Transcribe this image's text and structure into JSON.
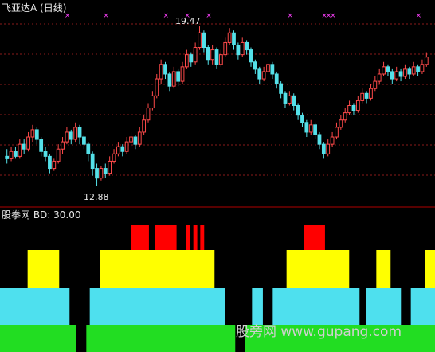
{
  "upper": {
    "title": "飞亚达A (日线)",
    "high_label": "19.47",
    "low_label": "12.88",
    "colors": {
      "up": "#ff4a4a",
      "down": "#54e0e8",
      "grid": "#8a1a1a",
      "marker": "#ff40ff",
      "border": "#b00000"
    },
    "candles": [
      [
        14.1,
        14.0,
        14.4,
        13.8
      ],
      [
        14.0,
        14.3,
        14.5,
        13.9
      ],
      [
        14.3,
        14.1,
        14.5,
        14.0
      ],
      [
        14.1,
        14.6,
        14.8,
        14.0
      ],
      [
        14.6,
        14.4,
        14.8,
        14.2
      ],
      [
        14.4,
        14.9,
        15.1,
        14.3
      ],
      [
        14.9,
        15.2,
        15.4,
        14.7
      ],
      [
        15.2,
        14.8,
        15.3,
        14.6
      ],
      [
        14.8,
        14.3,
        14.9,
        14.1
      ],
      [
        14.3,
        14.1,
        14.5,
        13.9
      ],
      [
        14.1,
        13.6,
        14.2,
        13.4
      ],
      [
        13.6,
        13.9,
        14.0,
        13.5
      ],
      [
        13.9,
        14.4,
        14.6,
        13.8
      ],
      [
        14.4,
        14.7,
        14.9,
        14.2
      ],
      [
        14.7,
        15.1,
        15.3,
        14.6
      ],
      [
        15.1,
        14.8,
        15.2,
        14.6
      ],
      [
        14.8,
        15.3,
        15.5,
        14.7
      ],
      [
        15.3,
        14.9,
        15.4,
        14.6
      ],
      [
        14.9,
        14.6,
        15.0,
        14.4
      ],
      [
        14.6,
        14.2,
        14.7,
        13.9
      ],
      [
        14.2,
        13.6,
        14.3,
        13.3
      ],
      [
        13.6,
        13.2,
        13.8,
        12.88
      ],
      [
        13.2,
        13.6,
        13.7,
        13.1
      ],
      [
        13.6,
        13.4,
        13.8,
        13.2
      ],
      [
        13.4,
        13.9,
        14.1,
        13.3
      ],
      [
        13.9,
        14.2,
        14.4,
        13.8
      ],
      [
        14.2,
        14.5,
        14.7,
        14.1
      ],
      [
        14.5,
        14.3,
        14.6,
        14.1
      ],
      [
        14.3,
        14.7,
        14.9,
        14.2
      ],
      [
        14.7,
        14.9,
        15.1,
        14.5
      ],
      [
        14.9,
        14.6,
        15.0,
        14.4
      ],
      [
        14.6,
        15.1,
        15.3,
        14.5
      ],
      [
        15.1,
        15.6,
        15.8,
        15.0
      ],
      [
        15.6,
        16.1,
        16.3,
        15.5
      ],
      [
        16.1,
        16.6,
        16.8,
        16.0
      ],
      [
        16.6,
        17.3,
        17.5,
        16.5
      ],
      [
        17.3,
        17.9,
        18.1,
        17.1
      ],
      [
        17.9,
        17.5,
        18.0,
        17.3
      ],
      [
        17.5,
        17.0,
        17.6,
        16.8
      ],
      [
        17.0,
        17.6,
        17.8,
        16.9
      ],
      [
        17.6,
        17.2,
        17.7,
        17.0
      ],
      [
        17.2,
        17.8,
        18.0,
        17.1
      ],
      [
        17.8,
        18.3,
        18.5,
        17.7
      ],
      [
        18.3,
        18.0,
        18.4,
        17.8
      ],
      [
        18.0,
        18.6,
        18.8,
        17.9
      ],
      [
        18.6,
        19.2,
        19.47,
        18.5
      ],
      [
        19.2,
        18.6,
        19.3,
        18.4
      ],
      [
        18.6,
        18.1,
        18.7,
        17.9
      ],
      [
        18.1,
        18.5,
        18.7,
        17.9
      ],
      [
        18.5,
        17.9,
        18.6,
        17.7
      ],
      [
        17.9,
        18.3,
        18.5,
        17.8
      ],
      [
        18.3,
        18.8,
        19.0,
        18.2
      ],
      [
        18.8,
        19.2,
        19.4,
        18.7
      ],
      [
        19.2,
        18.7,
        19.3,
        18.5
      ],
      [
        18.7,
        18.3,
        18.8,
        18.1
      ],
      [
        18.3,
        18.8,
        19.0,
        18.2
      ],
      [
        18.8,
        18.5,
        18.9,
        18.3
      ],
      [
        18.5,
        18.0,
        18.6,
        17.8
      ],
      [
        18.0,
        17.7,
        18.1,
        17.5
      ],
      [
        17.7,
        17.3,
        17.8,
        17.1
      ],
      [
        17.3,
        17.6,
        17.8,
        17.2
      ],
      [
        17.6,
        17.9,
        18.1,
        17.5
      ],
      [
        17.9,
        17.5,
        18.0,
        17.3
      ],
      [
        17.5,
        17.1,
        17.6,
        16.9
      ],
      [
        17.1,
        16.7,
        17.2,
        16.5
      ],
      [
        16.7,
        16.3,
        16.8,
        16.1
      ],
      [
        16.3,
        16.6,
        16.8,
        16.2
      ],
      [
        16.6,
        16.2,
        16.7,
        16.0
      ],
      [
        16.2,
        15.8,
        16.3,
        15.6
      ],
      [
        15.8,
        15.5,
        15.9,
        15.3
      ],
      [
        15.5,
        15.1,
        15.6,
        14.9
      ],
      [
        15.1,
        15.4,
        15.6,
        15.0
      ],
      [
        15.4,
        15.0,
        15.5,
        14.8
      ],
      [
        15.0,
        14.6,
        15.1,
        14.4
      ],
      [
        14.6,
        14.2,
        14.7,
        14.0
      ],
      [
        14.2,
        14.6,
        14.8,
        14.1
      ],
      [
        14.6,
        14.9,
        15.1,
        14.5
      ],
      [
        14.9,
        15.3,
        15.5,
        14.8
      ],
      [
        15.3,
        15.6,
        15.8,
        15.2
      ],
      [
        15.6,
        15.9,
        16.1,
        15.5
      ],
      [
        15.9,
        16.2,
        16.4,
        15.8
      ],
      [
        16.2,
        16.0,
        16.3,
        15.8
      ],
      [
        16.0,
        16.4,
        16.6,
        15.9
      ],
      [
        16.4,
        16.7,
        16.9,
        16.3
      ],
      [
        16.7,
        16.5,
        16.8,
        16.3
      ],
      [
        16.5,
        16.9,
        17.1,
        16.4
      ],
      [
        16.9,
        17.2,
        17.4,
        16.8
      ],
      [
        17.2,
        17.5,
        17.7,
        17.1
      ],
      [
        17.5,
        17.8,
        18.0,
        17.4
      ],
      [
        17.8,
        17.6,
        17.9,
        17.4
      ],
      [
        17.6,
        17.3,
        17.7,
        17.1
      ],
      [
        17.3,
        17.6,
        17.8,
        17.2
      ],
      [
        17.6,
        17.4,
        17.7,
        17.2
      ],
      [
        17.4,
        17.7,
        17.9,
        17.3
      ],
      [
        17.7,
        17.5,
        17.8,
        17.3
      ],
      [
        17.5,
        17.8,
        18.0,
        17.4
      ],
      [
        17.8,
        17.6,
        17.9,
        17.4
      ],
      [
        17.6,
        17.9,
        18.1,
        17.5
      ],
      [
        17.9,
        18.2,
        18.4,
        17.8
      ]
    ],
    "marker_days": [
      14,
      23,
      37,
      42,
      47,
      66,
      74,
      75,
      76,
      96,
      108,
      113,
      114,
      115,
      117,
      123
    ]
  },
  "lower": {
    "title": "股拳网 BD: 30.00",
    "colors": {
      "red": "#ff0000",
      "yellow": "#ffff00",
      "cyan": "#4ee0ee",
      "green": "#22dd22"
    },
    "levels": [
      2,
      2,
      2,
      2,
      2,
      2,
      2,
      2,
      3,
      3,
      3,
      3,
      3,
      3,
      3,
      3,
      3,
      2,
      2,
      2,
      1,
      1,
      0,
      0,
      0,
      1,
      2,
      2,
      2,
      3,
      3,
      3,
      3,
      3,
      3,
      3,
      3,
      3,
      4,
      4,
      4,
      4,
      4,
      3,
      3,
      4,
      4,
      4,
      4,
      4,
      4,
      3,
      3,
      3,
      4,
      3,
      4,
      3,
      4,
      3,
      3,
      3,
      2,
      2,
      2,
      1,
      1,
      1,
      0,
      0,
      0,
      1,
      1,
      2,
      2,
      2,
      1,
      1,
      1,
      2,
      2,
      2,
      2,
      3,
      3,
      3,
      3,
      3,
      4,
      4,
      4,
      4,
      4,
      4,
      3,
      3,
      3,
      3,
      3,
      3,
      3,
      2,
      2,
      2,
      1,
      1,
      2,
      2,
      2,
      3,
      3,
      3,
      3,
      2,
      2,
      2,
      1,
      1,
      1,
      2,
      2,
      2,
      2,
      3,
      3,
      3
    ]
  },
  "watermark": "股旁网 www.gupang.com"
}
